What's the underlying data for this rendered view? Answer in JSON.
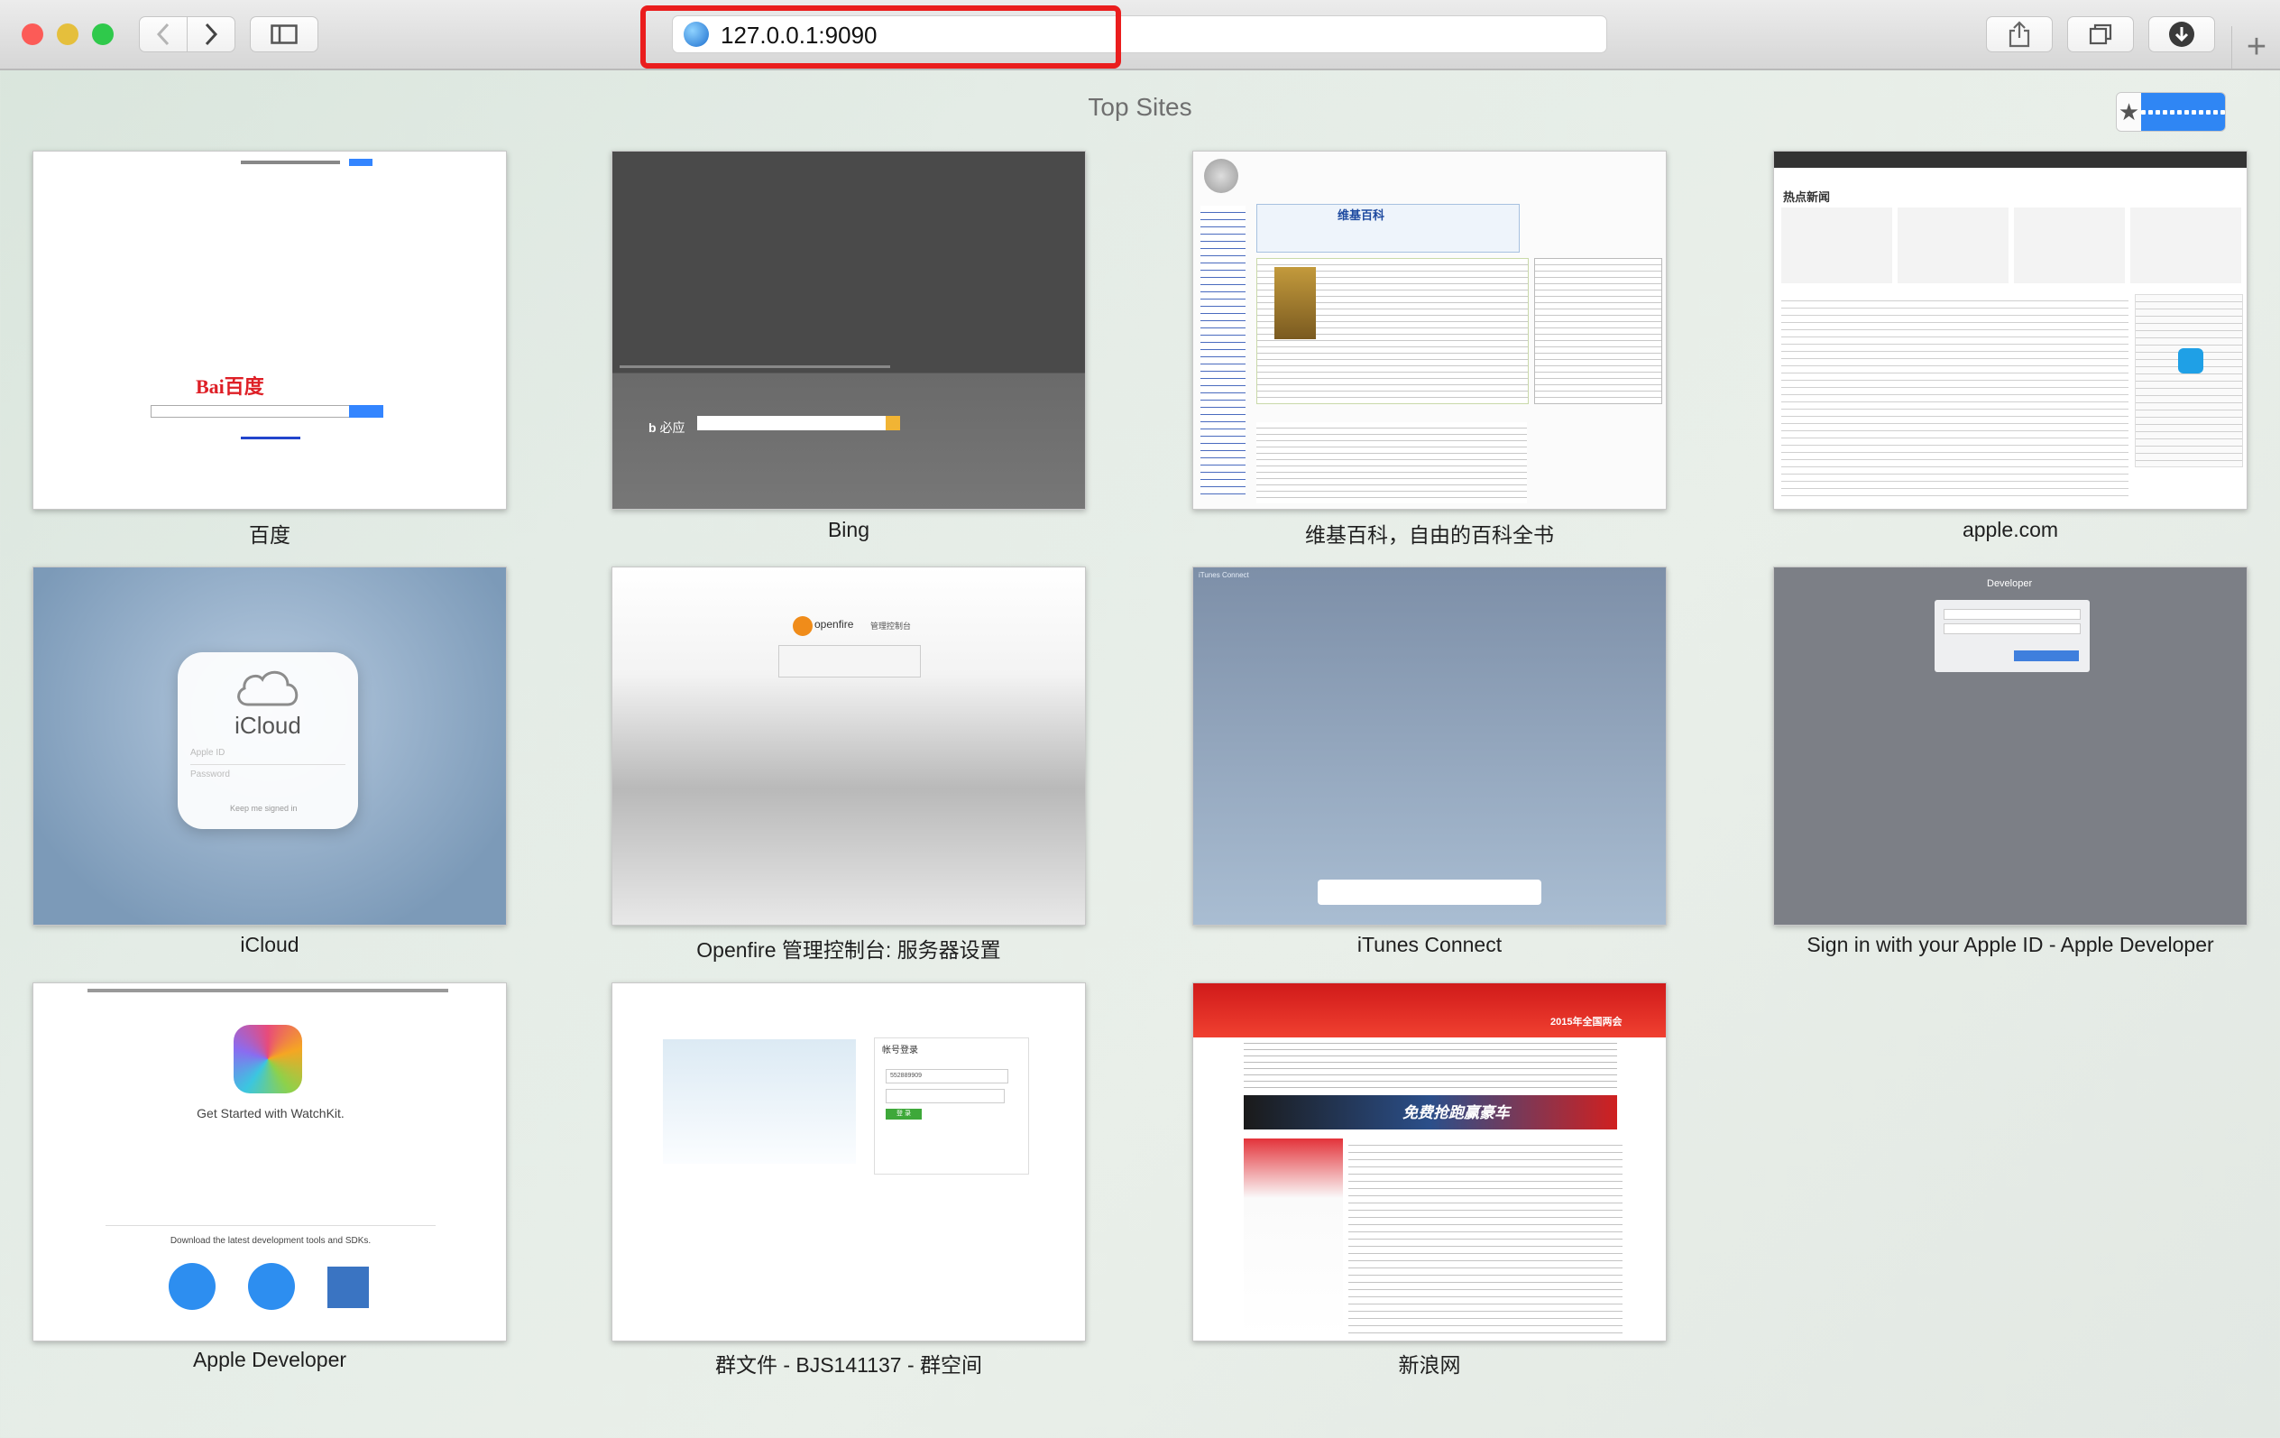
{
  "window": {
    "traffic_lights": [
      "#fc5b57",
      "#e5bf3c",
      "#2fc94b"
    ]
  },
  "toolbar": {
    "back_icon": "chevron-left-icon",
    "forward_icon": "chevron-right-icon",
    "sidebar_icon": "sidebar-icon",
    "address": "127.0.0.1:9090",
    "share_icon": "share-icon",
    "tabs_icon": "tabs-icon",
    "downloads_icon": "download-icon",
    "new_tab_icon": "plus-icon"
  },
  "top_sites": {
    "title": "Top Sites",
    "view_toggle": {
      "favorites_icon": "star-icon",
      "grid_icon": "grid-icon",
      "active": "grid"
    },
    "sites": [
      {
        "label": "百度",
        "preview": {
          "logo": "Bai百度"
        }
      },
      {
        "label": "Bing",
        "preview": {
          "logo": "必应"
        }
      },
      {
        "label": "维基百科，自由的百科全书",
        "preview": {
          "heading": "维基百科"
        }
      },
      {
        "label": "apple.com",
        "preview": {
          "heading": "热点新闻"
        }
      },
      {
        "label": "iCloud",
        "preview": {
          "heading": "iCloud",
          "field1": "Apple ID",
          "field2": "Password",
          "check": "Keep me signed in"
        }
      },
      {
        "label": "Openfire 管理控制台: 服务器设置",
        "preview": {
          "logo": "openfire",
          "sub": "管理控制台"
        }
      },
      {
        "label": "iTunes Connect",
        "preview": {
          "header": "iTunes Connect"
        }
      },
      {
        "label": "Sign in with your Apple ID - Apple Developer",
        "preview": {
          "heading": "Developer"
        }
      },
      {
        "label": "Apple Developer",
        "preview": {
          "heading": "Get Started with WatchKit.",
          "sub": "Download the latest development tools and SDKs."
        }
      },
      {
        "label": "群文件 - BJS141137 - 群空间",
        "preview": {
          "heading": "帐号登录",
          "field": "552889909",
          "button": "登 录"
        }
      },
      {
        "label": "新浪网",
        "preview": {
          "banner": "免费抢跑赢豪车",
          "year": "2015年全国两会"
        }
      }
    ]
  }
}
